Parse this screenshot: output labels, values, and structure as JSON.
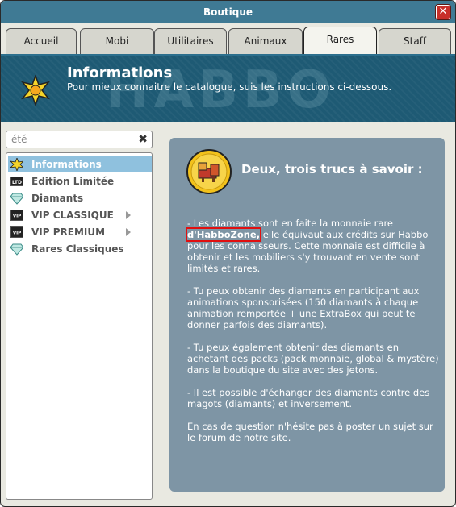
{
  "window": {
    "title": "Boutique",
    "close_label": "✕"
  },
  "tabs": [
    {
      "label": "Accueil",
      "active": false
    },
    {
      "label": "Mobi",
      "active": false
    },
    {
      "label": "Utilitaires",
      "active": false
    },
    {
      "label": "Animaux",
      "active": false
    },
    {
      "label": "Rares",
      "active": true
    },
    {
      "label": "Staff",
      "active": false
    }
  ],
  "header": {
    "title": "Informations",
    "subtitle": "Pour mieux connaitre le catalogue, suis les instructions ci-dessous.",
    "watermark": "HABBO"
  },
  "search": {
    "value": "été",
    "clear_icon": "clear-icon"
  },
  "sidebar": {
    "items": [
      {
        "label": "Informations",
        "icon": "star-info-icon",
        "active": true,
        "has_children": false
      },
      {
        "label": "Edition Limitée",
        "icon": "ltd-icon",
        "active": false,
        "has_children": false
      },
      {
        "label": "Diamants",
        "icon": "diamond-icon",
        "active": false,
        "has_children": false
      },
      {
        "label": "VIP CLASSIQUE",
        "icon": "vip-icon",
        "active": false,
        "has_children": true
      },
      {
        "label": "VIP PREMIUM",
        "icon": "vip-icon",
        "active": false,
        "has_children": true
      },
      {
        "label": "Rares Classiques",
        "icon": "diamond-icon",
        "active": false,
        "has_children": false
      }
    ]
  },
  "panel": {
    "title": "Deux, trois trucs à savoir :",
    "p1_before": "- Les diamants sont en faite la monnaie rare ",
    "p1_highlight": "d'HabboZone,",
    "p1_after": " elle équivaut aux crédits sur Habbo pour les connaisseurs. Cette monnaie est difficile à obtenir et les mobiliers s'y trouvant en vente sont limités et rares.",
    "p2": "- Tu peux obtenir des diamants en participant aux animations sponsorisées (150 diamants à chaque animation remportée + une ExtraBox qui peut te donner parfois des diamants).",
    "p3": "- Tu peux également obtenir des diamants en achetant des packs (pack monnaie, global & mystère) dans la boutique du site avec des jetons.",
    "p4": "- Il est possible d'échanger des diamants contre des magots (diamants) et inversement.",
    "p5": "En cas de question n'hésite pas à poster un sujet sur le forum de notre site."
  },
  "colors": {
    "titlebar": "#3f7a94",
    "header_bg": "#1e5a74",
    "panel_bg": "#7e95a5",
    "active_item": "#8fc1de",
    "highlight_border": "#e01010"
  }
}
